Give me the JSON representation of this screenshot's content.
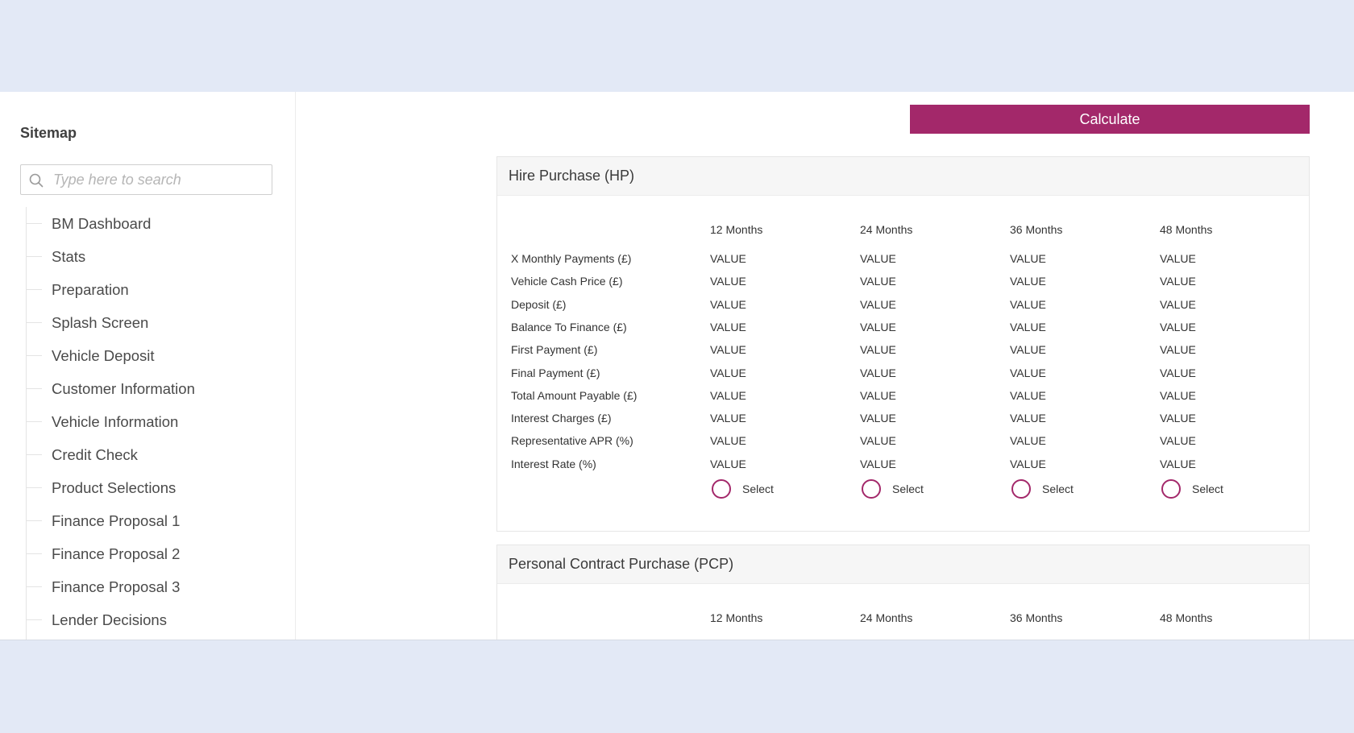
{
  "sidebar": {
    "title": "Sitemap",
    "search": {
      "placeholder": "Type here to search",
      "value": ""
    },
    "items": [
      {
        "label": "BM Dashboard"
      },
      {
        "label": "Stats"
      },
      {
        "label": "Preparation"
      },
      {
        "label": "Splash Screen"
      },
      {
        "label": "Vehicle Deposit"
      },
      {
        "label": "Customer Information"
      },
      {
        "label": "Vehicle Information"
      },
      {
        "label": "Credit Check"
      },
      {
        "label": "Product Selections"
      },
      {
        "label": "Finance Proposal 1"
      },
      {
        "label": "Finance Proposal 2"
      },
      {
        "label": "Finance Proposal 3"
      },
      {
        "label": "Lender Decisions"
      }
    ]
  },
  "toolbar": {
    "calculate_label": "Calculate"
  },
  "hp": {
    "title": "Hire Purchase (HP)",
    "columns": [
      "12 Months",
      "24 Months",
      "36 Months",
      "48 Months"
    ],
    "rows": [
      {
        "label": "X Monthly Payments (£)",
        "values": [
          "VALUE",
          "VALUE",
          "VALUE",
          "VALUE"
        ]
      },
      {
        "label": "Vehicle Cash Price (£)",
        "values": [
          "VALUE",
          "VALUE",
          "VALUE",
          "VALUE"
        ]
      },
      {
        "label": "Deposit (£)",
        "values": [
          "VALUE",
          "VALUE",
          "VALUE",
          "VALUE"
        ]
      },
      {
        "label": "Balance To Finance (£)",
        "values": [
          "VALUE",
          "VALUE",
          "VALUE",
          "VALUE"
        ]
      },
      {
        "label": "First Payment (£)",
        "values": [
          "VALUE",
          "VALUE",
          "VALUE",
          "VALUE"
        ]
      },
      {
        "label": "Final Payment (£)",
        "values": [
          "VALUE",
          "VALUE",
          "VALUE",
          "VALUE"
        ]
      },
      {
        "label": "Total Amount Payable (£)",
        "values": [
          "VALUE",
          "VALUE",
          "VALUE",
          "VALUE"
        ]
      },
      {
        "label": "Interest Charges (£)",
        "values": [
          "VALUE",
          "VALUE",
          "VALUE",
          "VALUE"
        ]
      },
      {
        "label": "Representative APR (%)",
        "values": [
          "VALUE",
          "VALUE",
          "VALUE",
          "VALUE"
        ]
      },
      {
        "label": "Interest Rate (%)",
        "values": [
          "VALUE",
          "VALUE",
          "VALUE",
          "VALUE"
        ]
      }
    ],
    "select_label": "Select"
  },
  "pcp": {
    "title": "Personal Contract Purchase (PCP)",
    "columns": [
      "12 Months",
      "24 Months",
      "36 Months",
      "48 Months"
    ]
  },
  "colors": {
    "accent": "#a3286a",
    "background": "#e3e9f6"
  }
}
